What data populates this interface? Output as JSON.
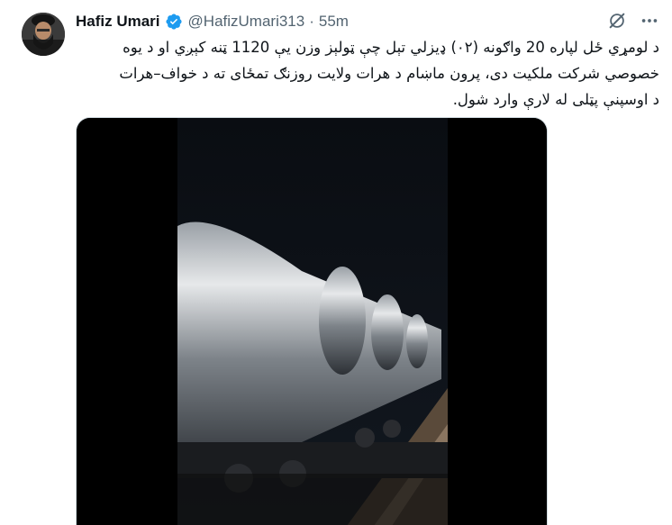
{
  "author": {
    "name": "Hafiz Umari",
    "handle": "@HafizUmari313",
    "separator": "·",
    "time": "55m",
    "verified": true
  },
  "icons": {
    "verified": "verified-badge-icon",
    "grok": "grok-icon",
    "more": "more-icon"
  },
  "tweet": {
    "lines": [
      "د لومړي ځل لپاره 20 واګونه (۰۲) ډيزلي تېل چې ټولېز وزن يې 1120 ټنه کېږي او د يوه",
      "خصوصي شرکت ملکيت دی، پرون ماښام د هرات ولايت روزنګ تمځای ته د خواف–هرات",
      "د اوسپنې پټلی له لارې وارد شول."
    ]
  },
  "media": {
    "type": "video",
    "description_icon": "video-frame"
  },
  "colors": {
    "verified": "#1d9bf0",
    "secondary_text": "#536471",
    "primary_text": "#0f1419"
  }
}
